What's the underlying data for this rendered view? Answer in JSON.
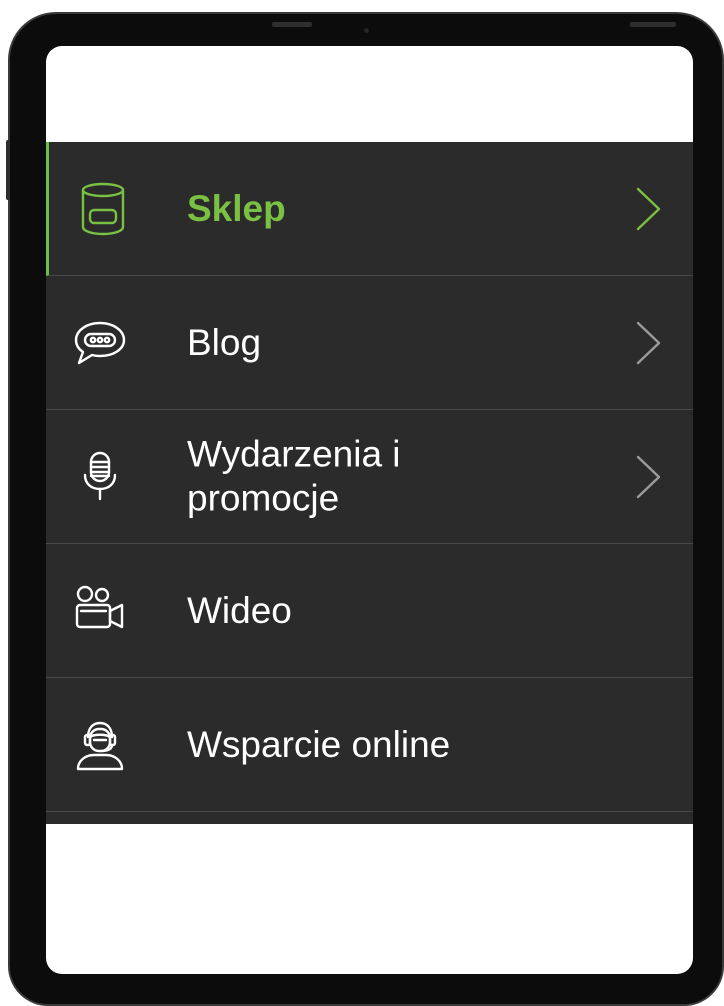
{
  "colors": {
    "menu_background": "#2b2b2b",
    "accent_green": "#7ac143",
    "text_white": "#ffffff",
    "chevron_grey": "#9a9a9a",
    "device_frame": "#0c0c0c"
  },
  "menu": {
    "items": [
      {
        "label": "Sklep",
        "icon": "database-cylinder-icon",
        "has_submenu": true,
        "active": true
      },
      {
        "label": "Blog",
        "icon": "speech-bubble-icon",
        "has_submenu": true,
        "active": false
      },
      {
        "label": "Wydarzenia i promocje",
        "icon": "microphone-icon",
        "has_submenu": true,
        "active": false
      },
      {
        "label": "Wideo",
        "icon": "video-camera-icon",
        "has_submenu": false,
        "active": false
      },
      {
        "label": "Wsparcie online",
        "icon": "support-agent-icon",
        "has_submenu": false,
        "active": false
      }
    ]
  }
}
